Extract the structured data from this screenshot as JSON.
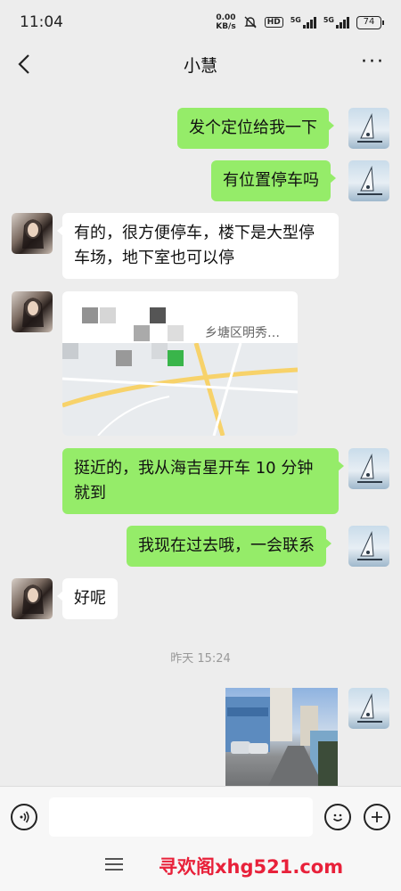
{
  "status_bar": {
    "time": "11:04",
    "net_speed_value": "0.00",
    "net_speed_unit": "KB/s",
    "hd": "HD",
    "sig1": "5G",
    "sig2": "5G",
    "battery": "74"
  },
  "header": {
    "title": "小慧",
    "more": "···",
    "back_icon": "chevron-left-icon"
  },
  "messages": [
    {
      "side": "out",
      "text": "发个定位给我一下"
    },
    {
      "side": "out",
      "text": "有位置停车吗"
    },
    {
      "side": "in",
      "text": "有的，很方便停车，楼下是大型停车场，地下室也可以停"
    },
    {
      "side": "in",
      "type": "location",
      "address": "乡塘区明秀…"
    },
    {
      "side": "out",
      "text": "挺近的，我从海吉星开车 10 分钟就到"
    },
    {
      "side": "out",
      "text": "我现在过去哦，一会联系"
    },
    {
      "side": "in",
      "text": "好呢"
    },
    {
      "side": "out",
      "type": "image"
    }
  ],
  "timestamp": "昨天 15:24",
  "input_bar": {
    "voice_icon": "voice-icon",
    "emoji_icon": "emoji-icon",
    "add_icon": "plus-icon",
    "placeholder": ""
  },
  "watermark": "寻欢阁xhg521.com",
  "colors": {
    "bubble_out": "#95ec69",
    "bubble_in": "#ffffff",
    "background": "#ededed",
    "watermark": "#e8213a"
  }
}
